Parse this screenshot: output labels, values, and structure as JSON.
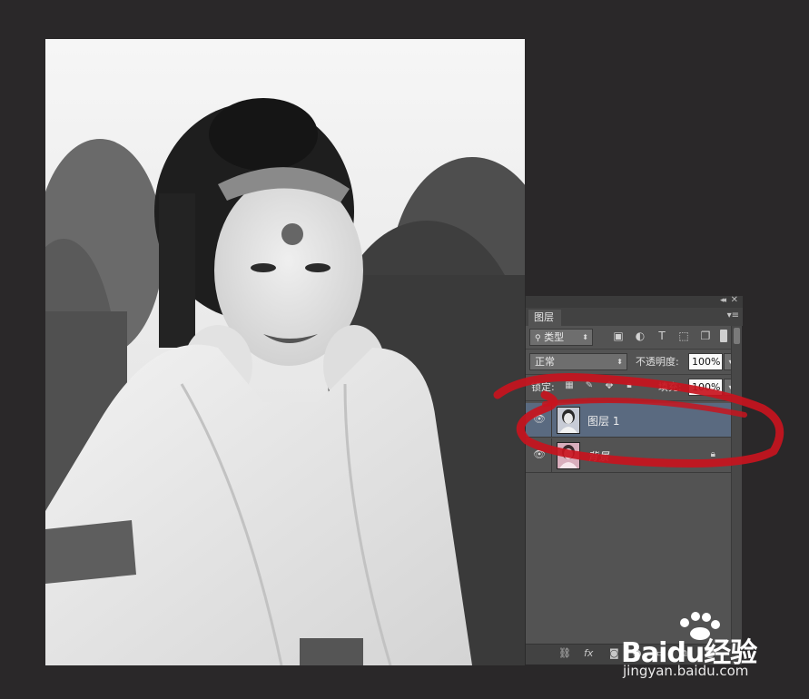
{
  "panel": {
    "tab_label": "图层",
    "filter_label": "类型",
    "blend_mode": "正常",
    "opacity_label": "不透明度:",
    "opacity_value": "100%",
    "lock_label": "锁定:",
    "fill_label": "填充:",
    "fill_value": "100%",
    "layers": [
      {
        "name": "图层 1",
        "active": true
      },
      {
        "name": "背景",
        "active": false,
        "locked": true
      }
    ],
    "bottom_icons": [
      "link-icon",
      "fx-icon",
      "mask-icon",
      "adjustment-icon",
      "group-icon",
      "new-layer-icon",
      "trash-icon"
    ],
    "fx_label": "fx"
  },
  "annotation_color": "#c8141e",
  "watermark": {
    "brand": "Baidu经验",
    "url": "jingyan.baidu.com"
  }
}
